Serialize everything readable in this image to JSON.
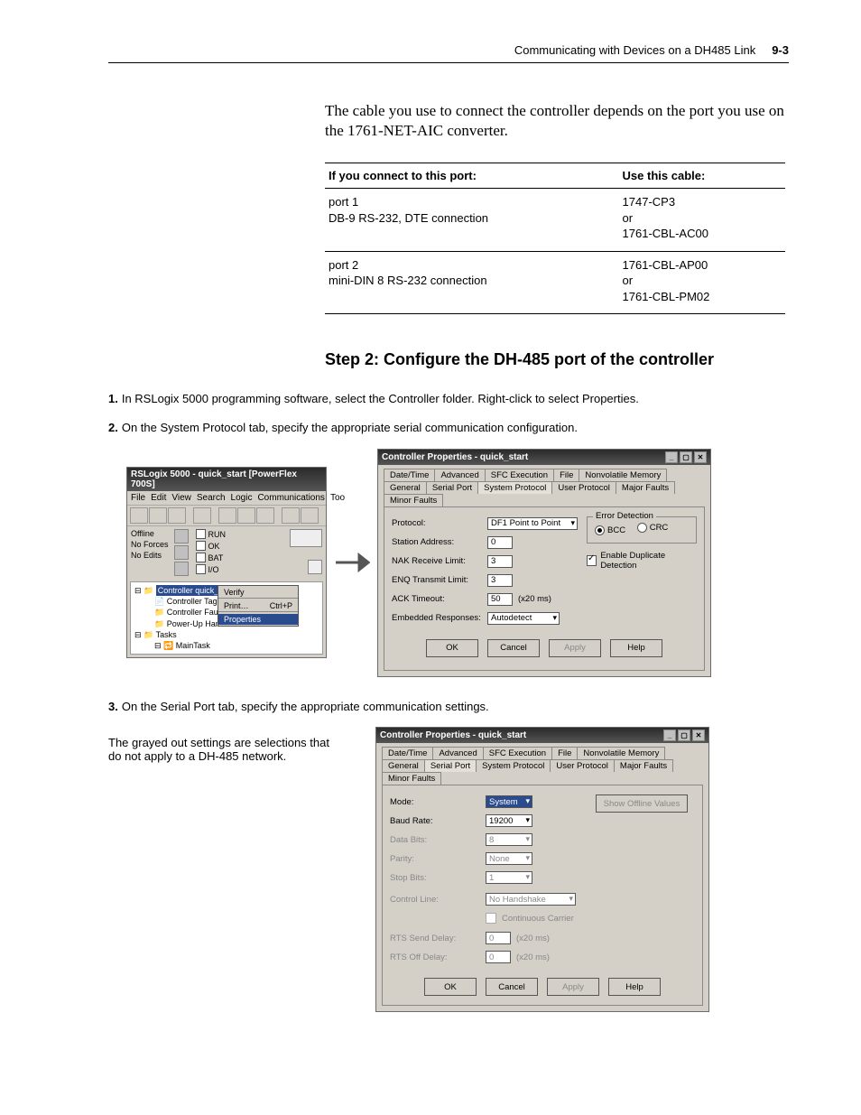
{
  "header": {
    "title": "Communicating with Devices on a DH485 Link",
    "page": "9-3"
  },
  "intro": "The cable you use to connect the controller depends on the port you use on the 1761-NET-AIC converter.",
  "table": {
    "h1": "If you connect to this port:",
    "h2": "Use this cable:",
    "r1c1": "port 1\nDB-9 RS-232, DTE connection",
    "r1c2": "1747-CP3\nor\n1761-CBL-AC00",
    "r2c1": "port 2\nmini-DIN 8 RS-232 connection",
    "r2c2": "1761-CBL-AP00\nor\n1761-CBL-PM02"
  },
  "step_heading": "Step 2: Configure the DH-485 port of the controller",
  "steps": {
    "s1": "In RSLogix 5000 programming software, select the Controller folder. Right-click to select Properties.",
    "s2": "On the System Protocol tab, specify the appropriate serial communication configuration.",
    "s3": "On the Serial Port tab, specify the appropriate communication settings."
  },
  "sidenote": "The grayed out settings are selections that do not apply to a DH-485 network.",
  "rslogix": {
    "title": "RSLogix 5000 - quick_start [PowerFlex 700S]",
    "menu": {
      "file": "File",
      "edit": "Edit",
      "view": "View",
      "search": "Search",
      "logic": "Logic",
      "comm": "Communications",
      "too": "Too"
    },
    "status": {
      "offline": "Offline",
      "noforces": "No Forces",
      "noedits": "No Edits",
      "run": "RUN",
      "ok": "OK",
      "bat": "BAT",
      "io": "I/O"
    },
    "tree": {
      "root": "Controller quick_start",
      "tags": "Controller Tags",
      "fault": "Controller Fault H",
      "power": "Power-Up Handle",
      "tasks": "Tasks",
      "main": "MainTask"
    },
    "ctx": {
      "verify": "Verify",
      "print": "Print…",
      "printshort": "Ctrl+P",
      "props": "Properties"
    }
  },
  "dlg": {
    "title": "Controller Properties - quick_start",
    "tabs1": {
      "dt": "Date/Time",
      "adv": "Advanced",
      "sfc": "SFC Execution",
      "file": "File",
      "nvm": "Nonvolatile Memory"
    },
    "tabs2": {
      "gen": "General",
      "sp": "Serial Port",
      "sys": "System Protocol",
      "up": "User Protocol",
      "maj": "Major Faults",
      "min": "Minor Faults"
    },
    "btns": {
      "ok": "OK",
      "cancel": "Cancel",
      "apply": "Apply",
      "help": "Help"
    }
  },
  "sysproto": {
    "protocol_lbl": "Protocol:",
    "protocol_val": "DF1 Point to Point",
    "station_lbl": "Station Address:",
    "station_val": "0",
    "nak_lbl": "NAK Receive Limit:",
    "nak_val": "3",
    "enq_lbl": "ENQ Transmit Limit:",
    "enq_val": "3",
    "ack_lbl": "ACK Timeout:",
    "ack_val": "50",
    "ack_unit": "(x20 ms)",
    "emb_lbl": "Embedded Responses:",
    "emb_val": "Autodetect",
    "err_grp": "Error Detection",
    "bcc": "BCC",
    "crc": "CRC",
    "dup": "Enable Duplicate Detection"
  },
  "serial": {
    "mode_lbl": "Mode:",
    "mode_val": "System",
    "baud_lbl": "Baud Rate:",
    "baud_val": "19200",
    "data_lbl": "Data Bits:",
    "data_val": "8",
    "parity_lbl": "Parity:",
    "parity_val": "None",
    "stop_lbl": "Stop Bits:",
    "stop_val": "1",
    "ctrl_lbl": "Control Line:",
    "ctrl_val": "No Handshake",
    "cont": "Continuous Carrier",
    "rsend_lbl": "RTS Send Delay:",
    "rsend_val": "0",
    "unit": "(x20 ms)",
    "roff_lbl": "RTS Off Delay:",
    "roff_val": "0",
    "show": "Show Offline Values"
  }
}
